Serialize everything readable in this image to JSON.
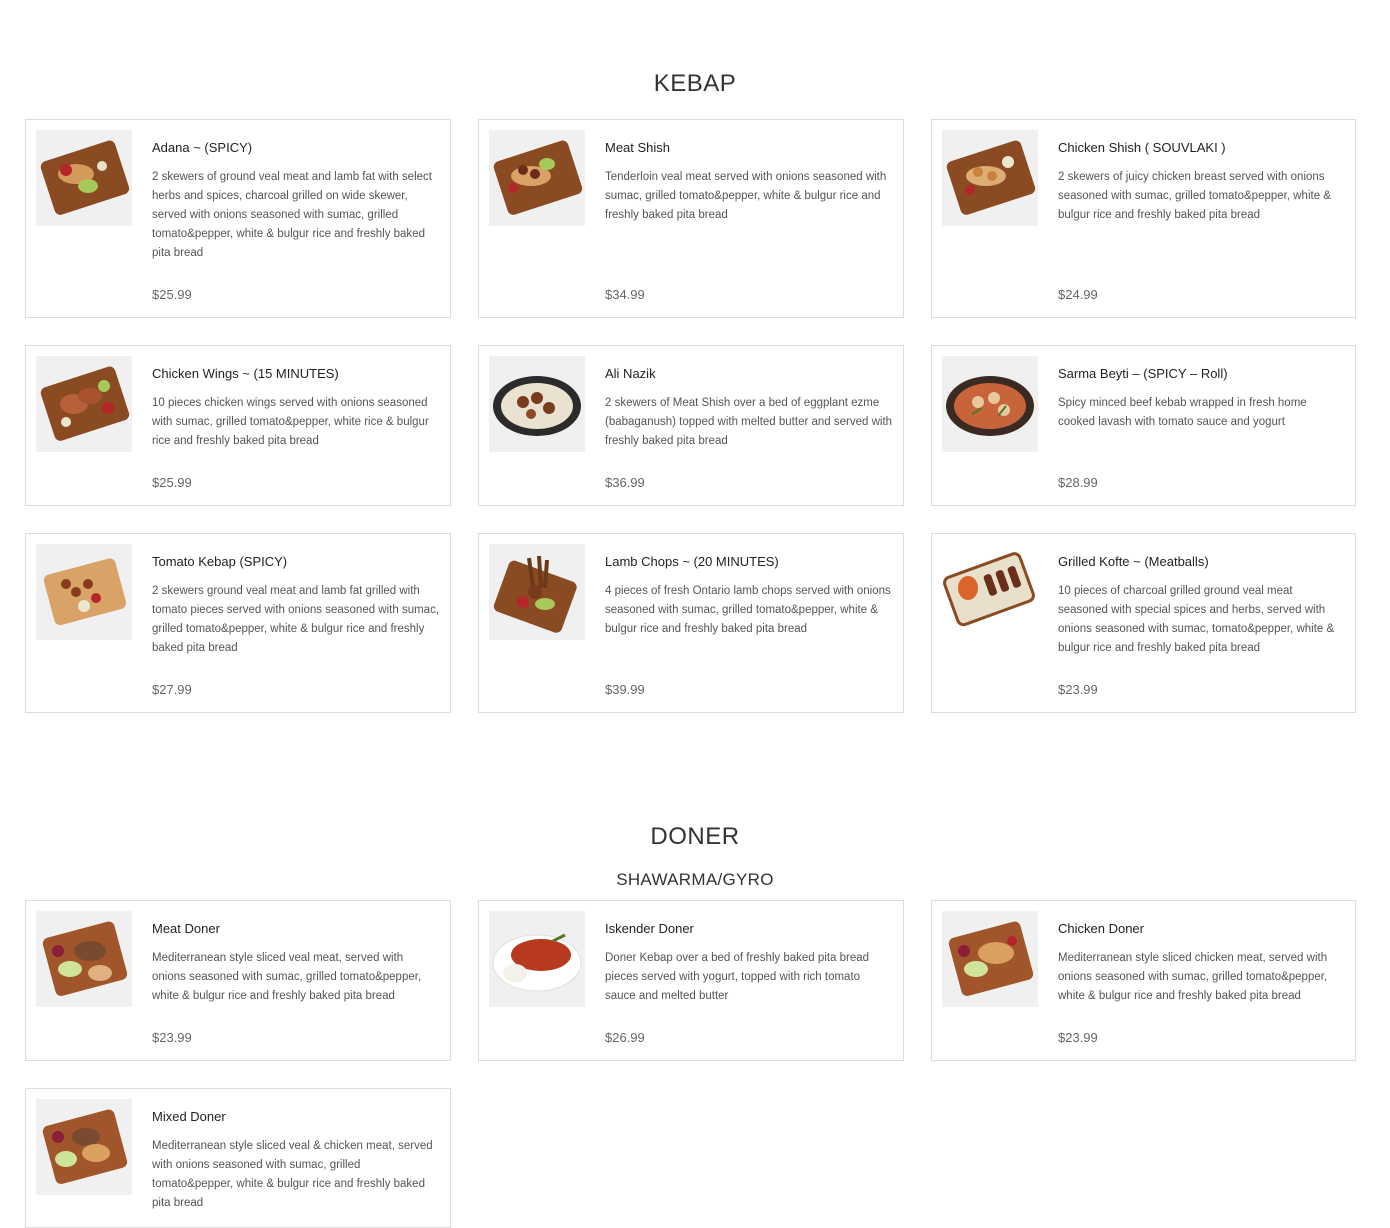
{
  "kebap": {
    "title": "KEBAP",
    "items": [
      {
        "name": "Adana ~ (SPICY)",
        "desc": "2 skewers of ground veal meat and lamb fat with select herbs and spices, charcoal grilled on wide skewer, served with onions seasoned with sumac, grilled tomato&pepper, white & bulgur rice and freshly baked pita bread",
        "price": "$25.99"
      },
      {
        "name": "Meat Shish",
        "desc": "Tenderloin veal meat served with onions seasoned with sumac, grilled tomato&pepper, white & bulgur rice and freshly baked pita bread",
        "price": "$34.99"
      },
      {
        "name": "Chicken Shish ( SOUVLAKI )",
        "desc": "2 skewers of juicy chicken breast served with onions seasoned with sumac, grilled tomato&pepper, white & bulgur rice and freshly baked pita bread",
        "price": "$24.99"
      },
      {
        "name": "Chicken Wings ~ (15 MINUTES)",
        "desc": "10 pieces chicken wings served with onions seasoned with sumac, grilled tomato&pepper, white rice & bulgur rice and freshly baked pita bread",
        "price": "$25.99"
      },
      {
        "name": "Ali Nazik",
        "desc": "2 skewers of Meat Shish over a bed of eggplant ezme (babaganush) topped with melted butter and served with freshly baked pita bread",
        "price": "$36.99"
      },
      {
        "name": "Sarma Beyti – (SPICY – Roll)",
        "desc": "Spicy minced beef kebab wrapped in fresh home cooked lavash with tomato sauce and yogurt",
        "price": "$28.99"
      },
      {
        "name": "Tomato Kebap (SPICY)",
        "desc": "2 skewers ground veal meat and lamb fat grilled with tomato pieces served with onions seasoned with sumac, grilled tomato&pepper, white & bulgur rice and freshly baked pita bread",
        "price": "$27.99"
      },
      {
        "name": "Lamb Chops ~ (20 MINUTES)",
        "desc": "4 pieces of fresh Ontario lamb chops served with onions seasoned with sumac, grilled tomato&pepper, white & bulgur rice and freshly baked pita bread",
        "price": "$39.99"
      },
      {
        "name": "Grilled Kofte ~ (Meatballs)",
        "desc": "10 pieces of charcoal grilled ground veal meat seasoned with special spices and herbs, served with onions seasoned with sumac, tomato&pepper, white & bulgur rice and freshly baked pita bread",
        "price": "$23.99"
      }
    ]
  },
  "doner": {
    "title": "DONER",
    "subtitle": "SHAWARMA/GYRO",
    "items": [
      {
        "name": "Meat Doner",
        "desc": "Mediterranean style sliced veal meat, served with onions seasoned with sumac, grilled tomato&pepper, white & bulgur rice and freshly baked pita bread",
        "price": "$23.99"
      },
      {
        "name": "Iskender Doner",
        "desc": "Doner Kebap over a bed of freshly baked pita bread pieces served with yogurt, topped with rich tomato sauce and melted butter",
        "price": "$26.99"
      },
      {
        "name": "Chicken Doner",
        "desc": "Mediterranean style sliced chicken meat, served with onions seasoned with sumac, grilled tomato&pepper, white & bulgur rice and freshly baked pita bread",
        "price": "$23.99"
      },
      {
        "name": "Mixed Doner",
        "desc": "Mediterranean style sliced veal & chicken meat, served with onions seasoned with sumac, grilled tomato&pepper, white & bulgur rice and freshly baked pita bread",
        "price": ""
      }
    ]
  },
  "colors": {
    "border": "#dcdcdc",
    "text": "#333333",
    "price": "#666666"
  }
}
